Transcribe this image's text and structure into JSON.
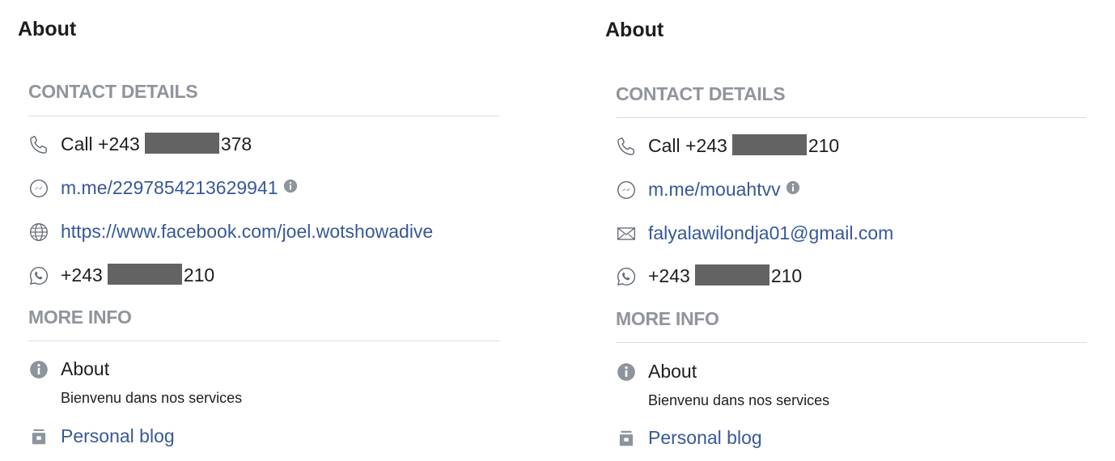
{
  "panels": [
    {
      "title": "About",
      "contact_heading": "CONTACT DETAILS",
      "phone": {
        "prefix": "Call +243",
        "suffix": "378"
      },
      "messenger": "m.me/2297854213629941",
      "website": "https://www.facebook.com/joel.wotshowadive",
      "whatsapp": {
        "prefix": "+243",
        "suffix": "210"
      },
      "more_heading": "MORE INFO",
      "about": {
        "label": "About",
        "text": "Bienvenu dans nos services"
      },
      "category": "Personal blog"
    },
    {
      "title": "About",
      "contact_heading": "CONTACT DETAILS",
      "phone": {
        "prefix": "Call +243",
        "suffix": "210"
      },
      "messenger": "m.me/mouahtvv",
      "email": "falyalawilondja01@gmail.com",
      "whatsapp": {
        "prefix": "+243",
        "suffix": "210"
      },
      "more_heading": "MORE INFO",
      "about": {
        "label": "About",
        "text": "Bienvenu dans nos services"
      },
      "category": "Personal blog"
    }
  ],
  "icons": {
    "phone": "phone-icon",
    "messenger": "messenger-icon",
    "globe": "globe-icon",
    "email": "envelope-icon",
    "whatsapp": "whatsapp-icon",
    "info": "info-icon",
    "category": "category-icon"
  },
  "colors": {
    "link": "#385898",
    "muted": "#90949c",
    "text": "#1c1e21",
    "redaction": "#636363"
  }
}
